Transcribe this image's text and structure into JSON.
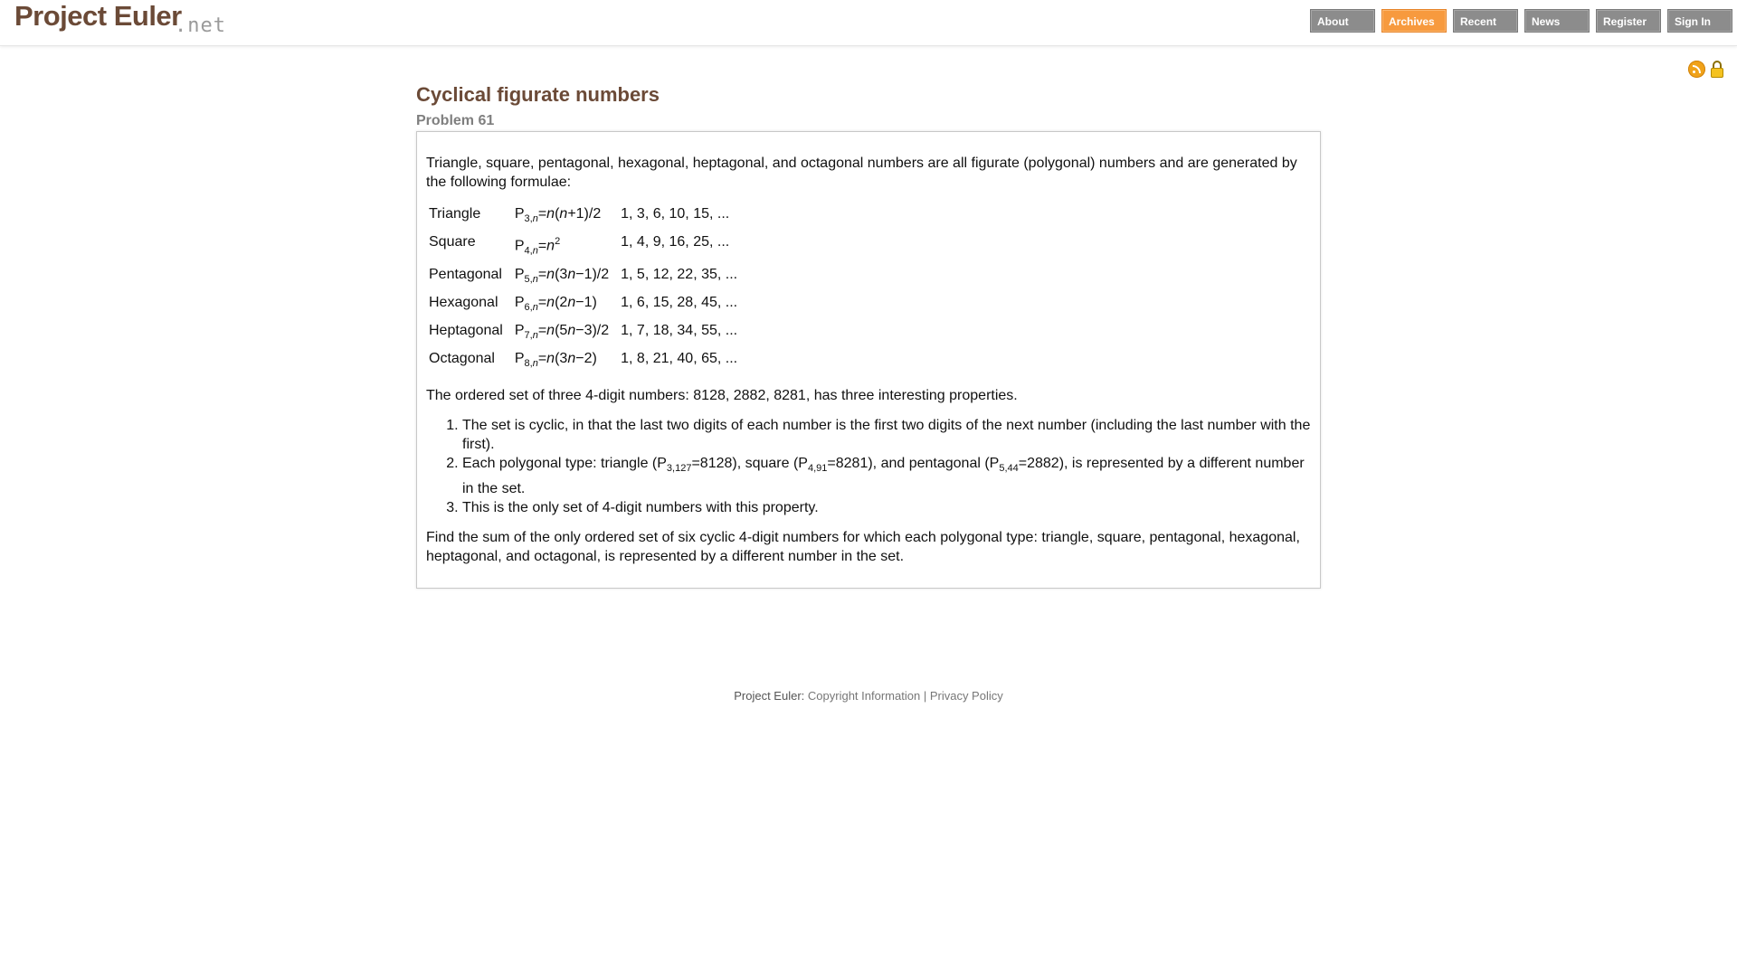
{
  "header": {
    "logo_main": "Project Euler",
    "logo_net": ".net",
    "nav": [
      {
        "label": "About"
      },
      {
        "label": "Archives"
      },
      {
        "label": "Recent"
      },
      {
        "label": "News"
      },
      {
        "label": "Register"
      },
      {
        "label": "Sign In"
      }
    ]
  },
  "problem": {
    "title": "Cyclical figurate numbers",
    "number": "Problem 61",
    "intro": "Triangle, square, pentagonal, hexagonal, heptagonal, and octagonal numbers are all figurate (polygonal) numbers and are generated by the following formulae:",
    "formulae": [
      {
        "name": "Triangle",
        "sub": "3,",
        "rhs_a": "=",
        "rhs_b": "(",
        "rhs_c": "+1)/2",
        "seq": "1, 3, 6, 10, 15, ..."
      },
      {
        "name": "Square",
        "sub": "4,",
        "seq": "1, 4, 9, 16, 25, ..."
      },
      {
        "name": "Pentagonal",
        "sub": "5,",
        "rhs_c": "(3",
        "rhs_d": "−1)/2",
        "seq": "1, 5, 12, 22, 35, ..."
      },
      {
        "name": "Hexagonal",
        "sub": "6,",
        "rhs_c": "(2",
        "rhs_d": "−1)",
        "seq": "1, 6, 15, 28, 45, ..."
      },
      {
        "name": "Heptagonal",
        "sub": "7,",
        "rhs_c": "(5",
        "rhs_d": "−3)/2",
        "seq": "1, 7, 18, 34, 55, ..."
      },
      {
        "name": "Octagonal",
        "sub": "8,",
        "rhs_c": "(3",
        "rhs_d": "−2)",
        "seq": "1, 8, 21, 40, 65, ..."
      }
    ],
    "ordered_set": "The ordered set of three 4-digit numbers: 8128, 2882, 8281, has three interesting properties.",
    "properties": {
      "item1": "The set is cyclic, in that the last two digits of each number is the first two digits of the next number (including the last number with the first).",
      "item2_a": "Each polygonal type: triangle (P",
      "item2_sub1": "3,127",
      "item2_b": "=8128), square (P",
      "item2_sub2": "4,91",
      "item2_c": "=8281), and pentagonal (P",
      "item2_sub3": "5,44",
      "item2_d": "=2882), is represented by a different number in the set.",
      "item3": "This is the only set of 4-digit numbers with this property."
    },
    "question": "Find the sum of the only ordered set of six cyclic 4-digit numbers for which each polygonal type: triangle, square, pentagonal, hexagonal, heptagonal, and octagonal, is represented by a different number in the set."
  },
  "footer": {
    "prefix": "Project Euler:",
    "copyright": "Copyright Information",
    "separator": "|",
    "privacy": "Privacy Policy"
  },
  "icons": {
    "rss": "rss-icon",
    "lock": "lock-icon"
  },
  "colors": {
    "brand": "#6b4a37",
    "nav_default": "#8c8c8c",
    "nav_active": "#f79a3e",
    "rss": "#f0a21a",
    "lock": "#f4c220"
  }
}
